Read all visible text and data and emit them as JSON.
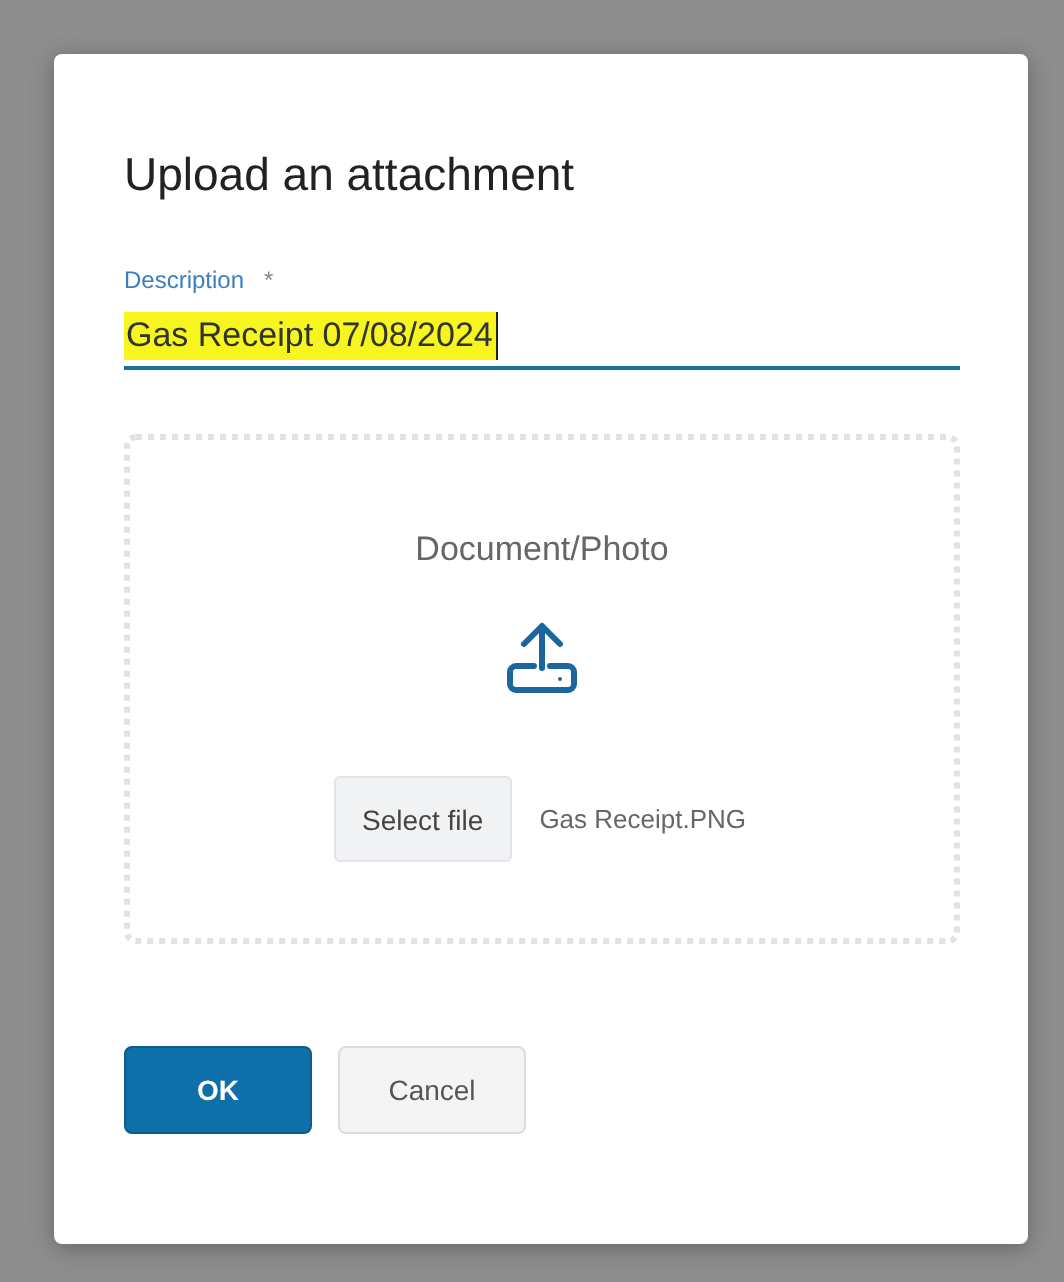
{
  "dialog": {
    "title": "Upload an attachment",
    "description_field": {
      "label": "Description",
      "required_mark": "*",
      "value": "Gas Receipt 07/08/2024",
      "focused": true
    },
    "dropzone": {
      "heading": "Document/Photo",
      "select_button": "Select file",
      "file_name": "Gas Receipt.PNG"
    },
    "buttons": [
      {
        "label": "OK",
        "kind": "primary"
      },
      {
        "label": "Cancel",
        "kind": "secondary"
      }
    ]
  }
}
